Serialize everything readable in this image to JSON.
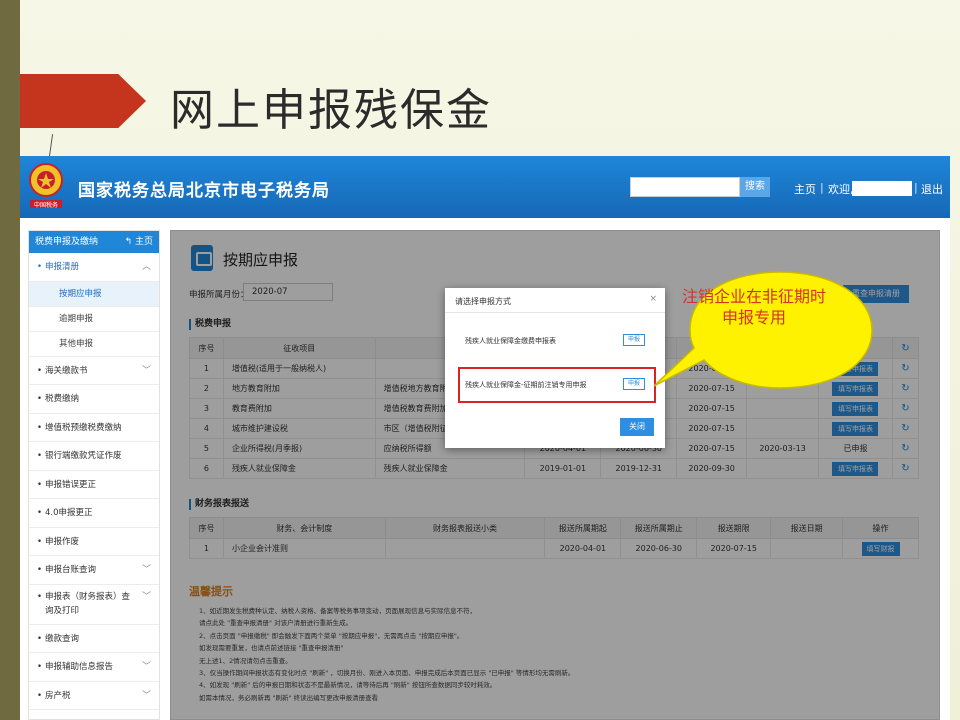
{
  "slide": {
    "title": "网上申报残保金"
  },
  "header": {
    "site_title": "国家税务总局北京市电子税务局",
    "emblem_text": "中国税务",
    "search_label": "搜索",
    "home_label": "主页",
    "welcome_label": "欢迎,",
    "logout_label": "退出"
  },
  "sidebar": {
    "head_label": "税费申报及缴纳",
    "head_home": "主页",
    "group_label": "申报清册",
    "sub_items": [
      "按期应申报",
      "逾期申报",
      "其他申报"
    ],
    "items": [
      "海关缴款书",
      "税费缴纳",
      "增值税预缴税费缴纳",
      "银行端缴款凭证作废",
      "申报错误更正",
      "4.0申报更正",
      "申报作废",
      "申报台账查询",
      "申报表（财务报表）查询及打印",
      "缴款查询",
      "申报辅助信息报告",
      "房产税"
    ]
  },
  "content": {
    "page_title": "按期应申报",
    "month_label": "申报所属月份：",
    "month_value": "2020-07",
    "reset_button": "重查申报清册",
    "tax_section": "税费申报",
    "tax_headers": [
      "序号",
      "征收项目",
      "征",
      "",
      "",
      "",
      "",
      "操作",
      ""
    ],
    "tax_rows": [
      {
        "no": "1",
        "item": "增值税(适用于一般纳税人)",
        "sub": "",
        "start": "",
        "end": "",
        "deadline": "2020-07-15",
        "date": "",
        "action": "填写申报表"
      },
      {
        "no": "2",
        "item": "地方教育附加",
        "sub": "增值税地方教育附加",
        "start": "",
        "end": "",
        "deadline": "2020-07-15",
        "date": "",
        "action": "填写申报表"
      },
      {
        "no": "3",
        "item": "教育费附加",
        "sub": "增值税教育费附加",
        "start": "",
        "end": "",
        "deadline": "2020-07-15",
        "date": "",
        "action": "填写申报表"
      },
      {
        "no": "4",
        "item": "城市维护建设税",
        "sub": "市区（增值税附征",
        "start": "",
        "end": "",
        "deadline": "2020-07-15",
        "date": "",
        "action": "填写申报表"
      },
      {
        "no": "5",
        "item": "企业所得税(月季报)",
        "sub": "应纳税所得额",
        "start": "2020-04-01",
        "end": "2020-06-30",
        "deadline": "2020-07-15",
        "date": "2020-03-13",
        "action": "已申报"
      },
      {
        "no": "6",
        "item": "残疾人就业保障金",
        "sub": "残疾人就业保障金",
        "start": "2019-01-01",
        "end": "2019-12-31",
        "deadline": "2020-09-30",
        "date": "",
        "action": "填写申报表"
      }
    ],
    "fin_section": "财务报表报送",
    "fin_headers": [
      "序号",
      "财务、会计制度",
      "财务报表报送小类",
      "报送所属期起",
      "报送所属期止",
      "报送期限",
      "报送日期",
      "操作"
    ],
    "fin_rows": [
      {
        "no": "1",
        "system": "小企业会计准则",
        "sub": "",
        "start": "2020-04-01",
        "end": "2020-06-30",
        "deadline": "2020-07-15",
        "date": "",
        "action": "填写财报"
      }
    ],
    "tips_title": "温馨提示",
    "tips": [
      "1、如近期发生税费种认定、纳税人资格、备案等税务事项变动，页面展现信息与实际信息不符，",
      "请点此处 \"重查申报清册\" 对该户清册进行重新生成。",
      "2、点击页面 \"申报缴税\" 即会触发下面两个菜单 \"按期应申报\"，无需再点击 \"按期应申报\"。",
      "如发现需要重复，也请点前述链接 \"重查申报清册\"",
      "无上述1、2情况请勿点击重查。",
      "3、仅当操作期间申报状态有变化时点 \"刷新\" ，切换月份、刚进入本页面、申报完成后本页面已显示 \"已申报\" 等情形均无需刷新。",
      "4、如发现 \"刷新\" 后的申报日期和状态不是最新情况，请等待后再 \"刷新\" 按钮所查数据同步较时耗效。",
      "如需本情况，务必刷新再 \"刷新\" 终读出编写更改申报清册查看"
    ]
  },
  "modal": {
    "title": "请选择申报方式",
    "close_glyph": "×",
    "option1": "残疾人就业保障金缴费申报表",
    "option2": "残疾人就业保障金-征期前注销专用申报",
    "option_button": "申报",
    "close_button": "关闭"
  },
  "callout": {
    "text": "注销企业在非征期时申报专用"
  },
  "colors": {
    "brand_blue": "#1f86d8",
    "accent_red": "#c5341c",
    "callout_yellow": "#fff200",
    "callout_red": "#d4322b"
  }
}
